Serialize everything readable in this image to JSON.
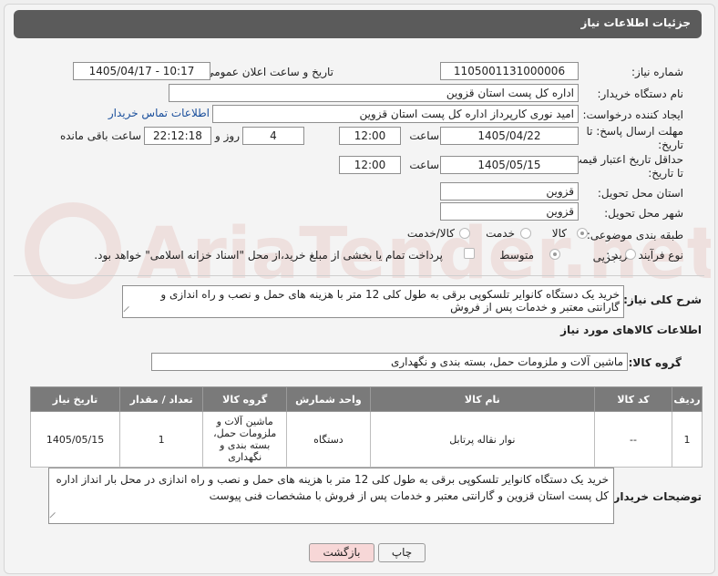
{
  "header": {
    "title": "جزئیات اطلاعات نیاز"
  },
  "fields": {
    "need_number_label": "شماره نیاز:",
    "need_number": "1105001131000006",
    "announce_label": "تاریخ و ساعت اعلان عمومی:",
    "announce_value": "1405/04/17 - 10:17",
    "buyer_org_label": "نام دستگاه خریدار:",
    "buyer_org": "اداره کل پست استان قزوین",
    "creator_label": "ایجاد کننده درخواست:",
    "creator": "امید نوری کارپرداز اداره کل پست استان قزوین",
    "contact_link": "اطلاعات تماس خریدار",
    "deadline_label": "مهلت ارسال پاسخ: تا تاریخ:",
    "deadline_date": "1405/04/22",
    "time_label": "ساعت",
    "deadline_time": "12:00",
    "days_count": "4",
    "days_and_label": "روز و",
    "remaining_time": "22:12:18",
    "remaining_label": "ساعت باقی مانده",
    "validity_label": "حداقل تاریخ اعتبار قیمت: تا تاریخ:",
    "validity_date": "1405/05/15",
    "validity_time": "12:00",
    "province_label": "استان محل تحویل:",
    "province": "قزوین",
    "city_label": "شهر محل تحویل:",
    "city": "قزوین",
    "category_label": "طبقه بندی موضوعی:",
    "category_options": [
      "کالا",
      "خدمت",
      "کالا/خدمت"
    ],
    "process_label": "نوع فرآیند خرید :",
    "process_options": [
      "جزیی",
      "متوسط"
    ],
    "payment_text": "پرداخت تمام یا بخشی از مبلغ خرید،از محل \"اسناد خزانه اسلامی\" خواهد بود.",
    "description_label": "شرح کلی نیاز:",
    "description": "خرید یک دستگاه کانوایر تلسکوپی برقی به طول کلی 12 متر با هزینه های حمل و نصب و راه اندازی و گارانتی معتبر و خدمات پس از فروش",
    "goods_info_title": "اطلاعات کالاهای مورد نیاز",
    "goods_group_label": "گروه کالا:",
    "goods_group": "ماشین آلات و ملزومات حمل، بسته بندی و نگهداری"
  },
  "table": {
    "headers": [
      "ردیف",
      "کد کالا",
      "نام کالا",
      "واحد شمارش",
      "گروه کالا",
      "تعداد / مقدار",
      "تاریخ نیاز"
    ],
    "rows": [
      [
        "1",
        "--",
        "نوار نقاله پرتابل",
        "دستگاه",
        "ماشین آلات و ملزومات حمل، بسته بندی و نگهداری",
        "1",
        "1405/05/15"
      ]
    ]
  },
  "buyer_notes_label": "توضیحات خریدار:",
  "buyer_notes": "خرید یک دستگاه کانوایر تلسکوپی برقی به طول کلی 12 متر با هزینه های حمل و نصب و راه اندازی در محل بار انداز اداره کل پست استان قزوین و گارانتی معتبر و خدمات پس از فروش با مشخصات فنی پیوست",
  "buttons": {
    "print": "چاپ",
    "back": "بازگشت"
  },
  "watermark_text": "AriaTender.net",
  "colors": {
    "header": "#5b5b5b",
    "table_header": "#7a7a7a",
    "back_button": "#f7d7d7",
    "link": "#1a4f9c"
  }
}
